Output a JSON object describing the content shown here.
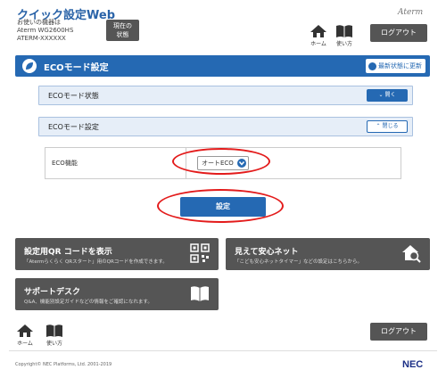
{
  "header": {
    "title": "クイック設定Web",
    "device_line1": "お使いの機器は",
    "device_line2": "Aterm WG2600HS",
    "device_line3": "ATERM-XXXXXX",
    "status_line1": "現在の",
    "status_line2": "状態",
    "brand": "Aterm",
    "home_label": "ホーム",
    "help_label": "使い方",
    "logout_label": "ログアウト"
  },
  "eco_panel": {
    "title": "ECOモード設定",
    "refresh_label": "最新状態に更新",
    "status_section": {
      "title": "ECOモード状態",
      "toggle_label": "開く"
    },
    "settings_section": {
      "title": "ECOモード設定",
      "toggle_label": "閉じる"
    },
    "eco_function_label": "ECO機能",
    "eco_function_value": "オートECO",
    "submit_label": "設定"
  },
  "tiles": {
    "qr": {
      "title": "設定用QR コードを表示",
      "desc": "「Atermらくらく QRスタート」用のQRコードを作成できます。"
    },
    "safe": {
      "title": "見えて安心ネット",
      "desc": "「こども安心ネットタイマー」などの設定はこちらから。"
    },
    "support": {
      "title": "サポートデスク",
      "desc": "Q&A、機能別設定ガイドなどの情報をご確認になれます。"
    }
  },
  "footer": {
    "home_label": "ホーム",
    "help_label": "使い方",
    "logout_label": "ログアウト",
    "copyright": "Copyright© NEC Platforms, Ltd. 2001-2019",
    "nec": "NEC"
  },
  "colors": {
    "accent": "#2569b3",
    "dark_button": "#555555",
    "highlight": "#e31b1b",
    "section_bg": "#e6eef8"
  },
  "icons": [
    "leaf-icon",
    "refresh-icon",
    "home-icon",
    "book-icon",
    "chevron-down-icon",
    "chevron-up-icon",
    "qr-code-icon",
    "house-search-icon"
  ]
}
